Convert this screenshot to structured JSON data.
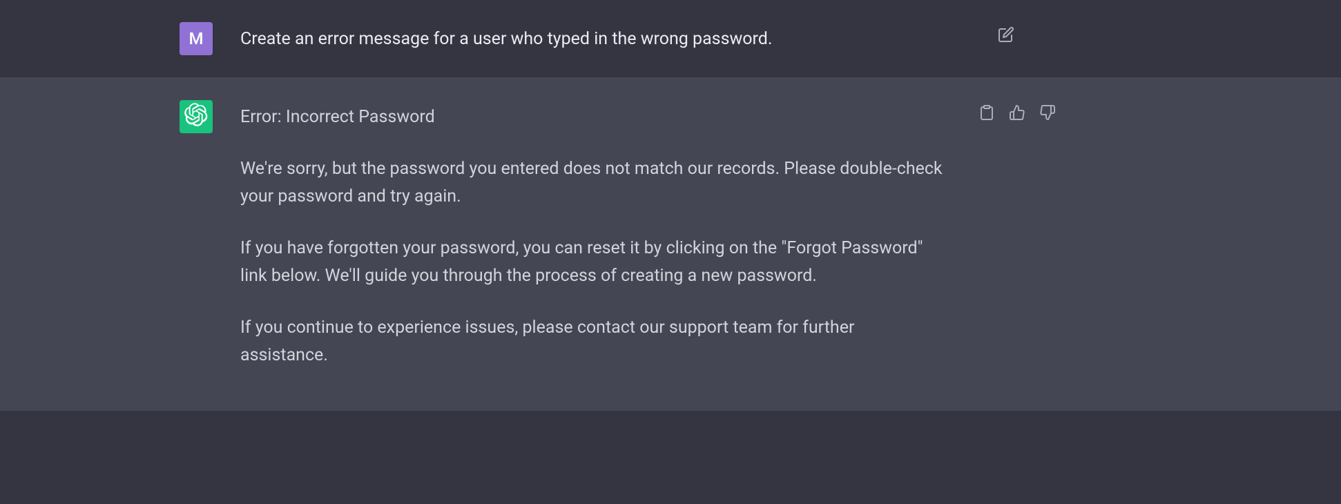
{
  "user": {
    "avatar_letter": "M",
    "message": "Create an error message for a user who typed in the wrong password."
  },
  "assistant": {
    "heading": "Error: Incorrect Password",
    "para1": "We're sorry, but the password you entered does not match our records. Please double-check your password and try again.",
    "para2": "If you have forgotten your password, you can reset it by clicking on the \"Forgot Password\" link below. We'll guide you through the process of creating a new password.",
    "para3": "If you continue to experience issues, please contact our support team for further assistance."
  }
}
